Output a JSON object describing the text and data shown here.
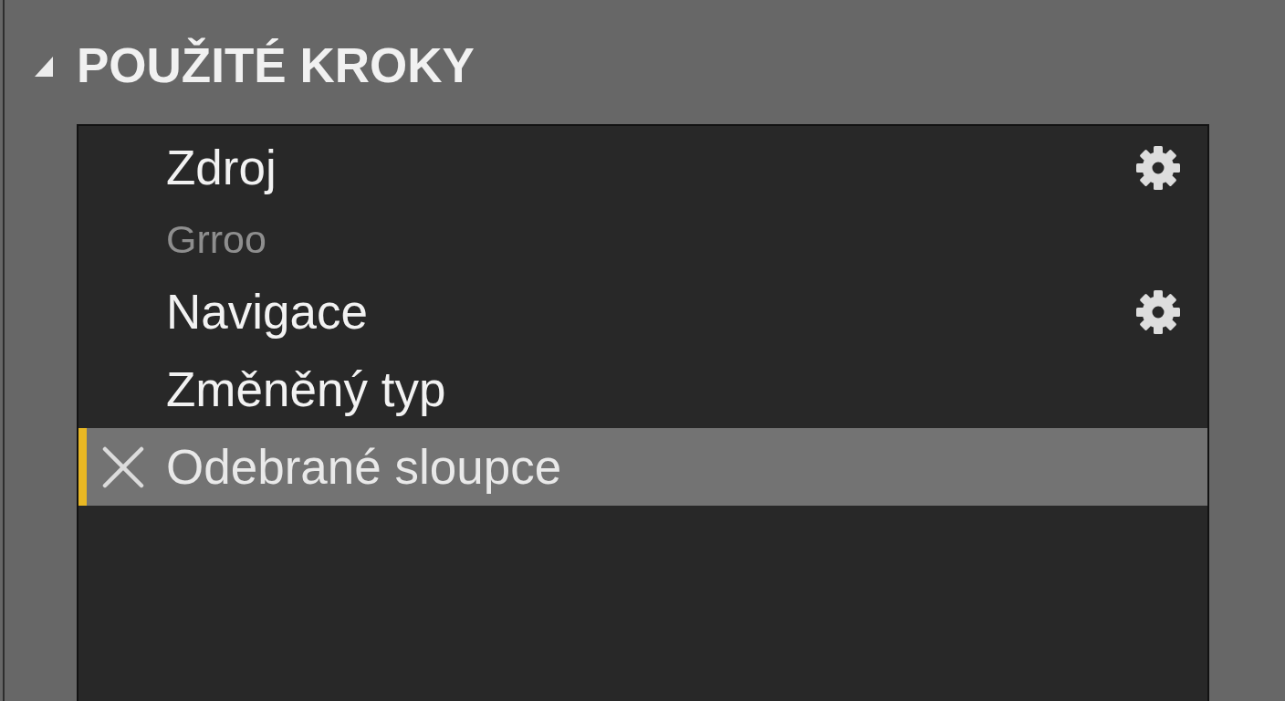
{
  "section": {
    "title": "POUŽITÉ KROKY",
    "expanded": true
  },
  "steps": [
    {
      "kind": "step",
      "label": "Zdroj",
      "settings": true,
      "selected": false
    },
    {
      "kind": "ghost",
      "label": "Grroo"
    },
    {
      "kind": "step",
      "label": "Navigace",
      "settings": true,
      "selected": false
    },
    {
      "kind": "step",
      "label": "Změněný typ",
      "settings": false,
      "selected": false
    },
    {
      "kind": "step",
      "label": "Odebrané sloupce",
      "settings": false,
      "selected": true
    }
  ]
}
